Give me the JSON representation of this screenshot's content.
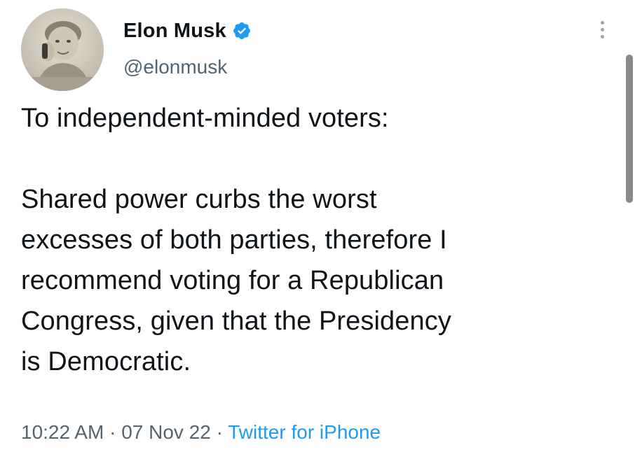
{
  "author": {
    "display_name": "Elon Musk",
    "handle": "@elonmusk",
    "verified": true,
    "avatar_icon": "child-photo-avatar"
  },
  "tweet": {
    "paragraph_1": "To independent-minded voters:",
    "paragraph_2": "Shared power curbs the worst\nexcesses of both parties, therefore I\nrecommend voting for a Republican\nCongress, given that the Presidency\nis Democratic."
  },
  "meta": {
    "time": "10:22 AM",
    "separator": "·",
    "date": "07 Nov 22",
    "source": "Twitter for iPhone"
  },
  "colors": {
    "text": "#0f1419",
    "secondary": "#536471",
    "link": "#1d9bf0",
    "verified_badge": "#1d9bf0"
  },
  "icons": {
    "more": "more-options-icon",
    "verified": "verified-badge-icon"
  }
}
